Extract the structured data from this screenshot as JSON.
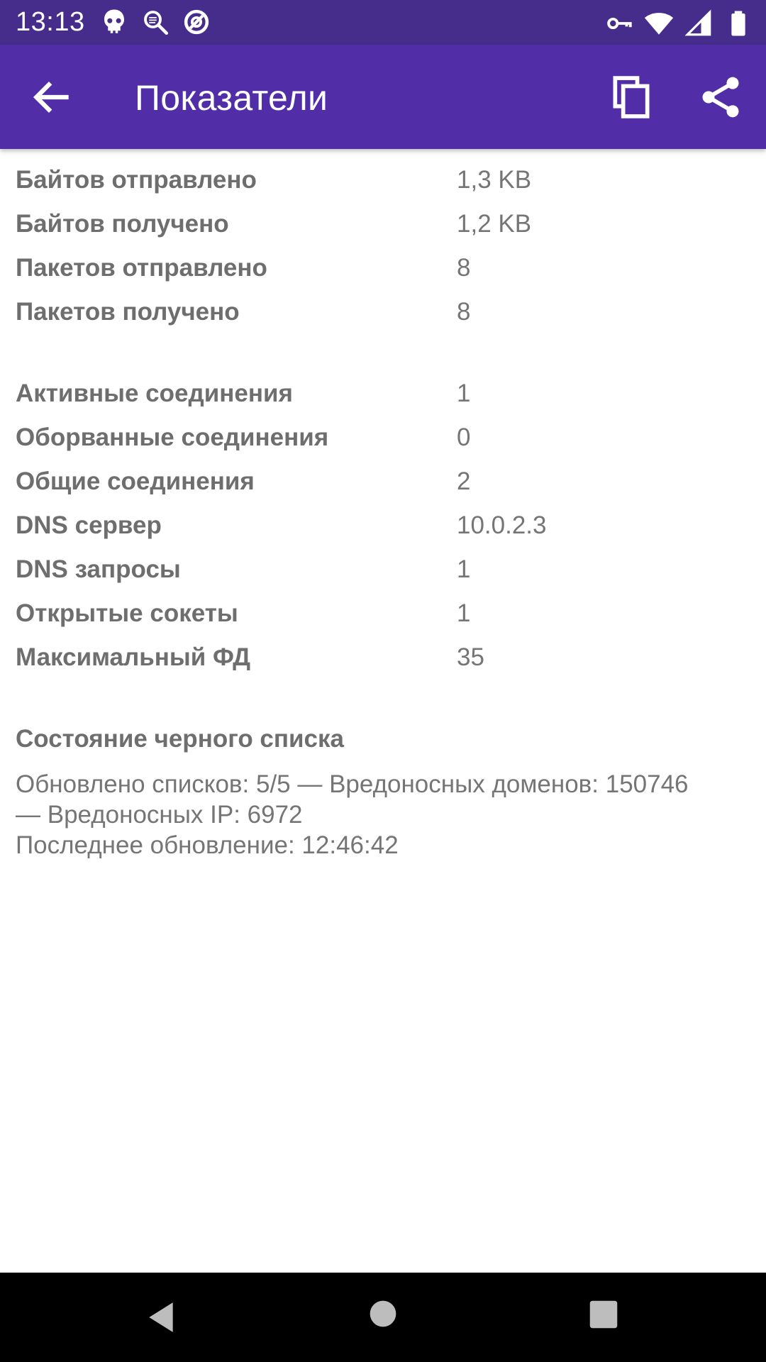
{
  "status_bar": {
    "time": "13:13",
    "left_icons": [
      "skull-icon",
      "search-lens-icon",
      "block-icon"
    ],
    "right_icons": [
      "vpn-key-icon",
      "wifi-icon",
      "cell-signal-icon",
      "battery-icon"
    ]
  },
  "app_bar": {
    "title": "Показатели",
    "back_icon": "arrow-back-icon",
    "actions": [
      "copy-icon",
      "share-icon"
    ],
    "background": "#512da8"
  },
  "stats_group1": [
    {
      "label": "Байтов отправлено",
      "value": "1,3 KB"
    },
    {
      "label": "Байтов получено",
      "value": "1,2 KB"
    },
    {
      "label": "Пакетов отправлено",
      "value": "8"
    },
    {
      "label": "Пакетов получено",
      "value": "8"
    }
  ],
  "stats_group2": [
    {
      "label": "Активные соединения",
      "value": "1"
    },
    {
      "label": "Оборванные соединения",
      "value": "0"
    },
    {
      "label": "Общие соединения",
      "value": "2"
    },
    {
      "label": "DNS сервер",
      "value": "10.0.2.3"
    },
    {
      "label": "DNS запросы",
      "value": "1"
    },
    {
      "label": "Открытые сокеты",
      "value": "1"
    },
    {
      "label": "Максимальный ФД",
      "value": "35"
    }
  ],
  "blacklist": {
    "title": "Состояние черного списка",
    "line1": "Обновлено списков: 5/5 — Вредоносных доменов: 150746",
    "line2": "— Вредоносных IP: 6972",
    "line3": "Последнее обновление: 12:46:42"
  },
  "nav_bar": {
    "buttons": [
      "nav-back-icon",
      "nav-home-icon",
      "nav-recents-icon"
    ]
  }
}
